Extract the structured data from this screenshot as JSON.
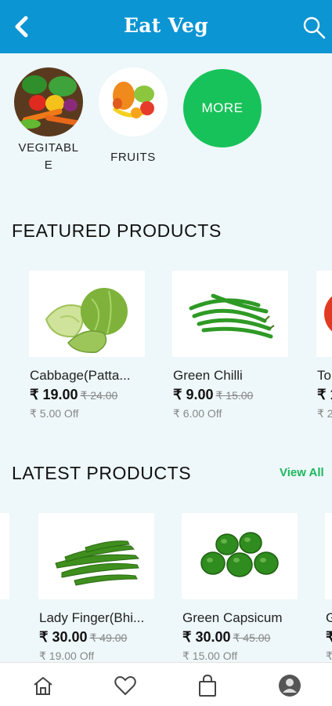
{
  "app_bar": {
    "title": "Eat Veg"
  },
  "categories": [
    {
      "label": "VEGITABL\nE"
    },
    {
      "label": "FRUITS"
    },
    {
      "label": "MORE"
    }
  ],
  "featured": {
    "title": "FEATURED PRODUCTS",
    "products": [
      {
        "name": "Cabbage(Patta...",
        "price": "₹ 19.00",
        "mrp": "₹ 24.00",
        "off": "₹ 5.00 Off"
      },
      {
        "name": "Green Chilli",
        "price": "₹ 9.00",
        "mrp": "₹ 15.00",
        "off": "₹ 6.00 Off"
      },
      {
        "name": "To",
        "price": "₹ 1",
        "mrp": "",
        "off": "₹ 2"
      }
    ]
  },
  "latest": {
    "title": "LATEST PRODUCTS",
    "view_all": "View All",
    "products": [
      {
        "name": "Lady Finger(Bhi...",
        "price": "₹ 30.00",
        "mrp": "₹ 49.00",
        "off": "₹ 19.00 Off"
      },
      {
        "name": "Green Capsicum",
        "price": "₹ 30.00",
        "mrp": "₹ 45.00",
        "off": "₹ 15.00 Off"
      },
      {
        "name": "G",
        "price": "₹",
        "mrp": "",
        "off": "₹"
      }
    ]
  },
  "bottom_nav": [
    "home-icon",
    "heart-icon",
    "bag-icon",
    "profile-icon"
  ],
  "colors": {
    "app_bar": "#0b95d2",
    "accent_green": "#18c25a",
    "background": "#eef7f9"
  }
}
